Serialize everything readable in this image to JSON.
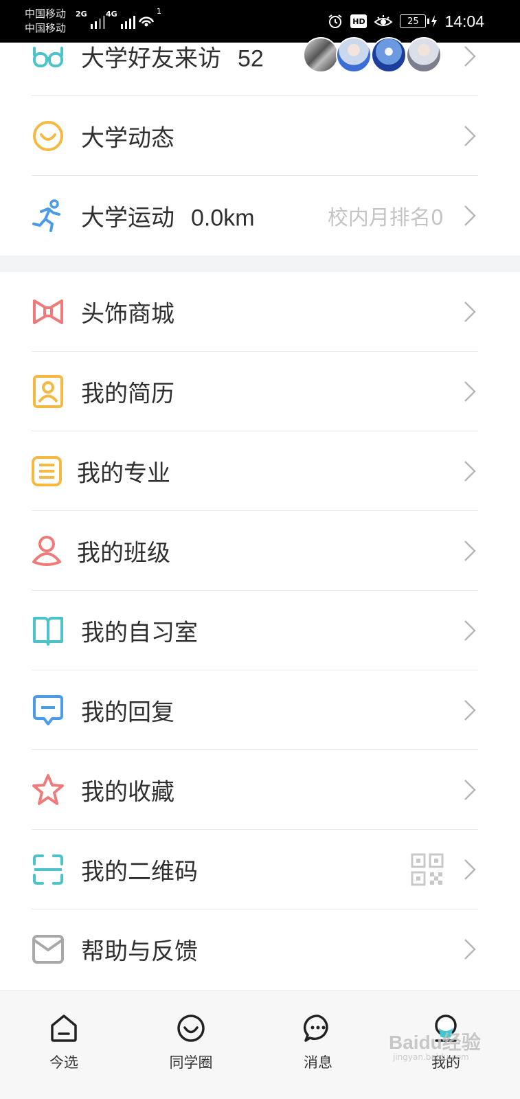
{
  "status_bar": {
    "carrier_1": "中国移动",
    "carrier_2": "中国移动",
    "network_1": "2G",
    "network_2": "4G",
    "hotspot_count": "1",
    "hd": "HD",
    "battery": "25",
    "time": "14:04"
  },
  "top_section": {
    "friend_visits": {
      "label": "大学好友来访",
      "count": "52"
    },
    "dynamics": {
      "label": "大学动态"
    },
    "sports": {
      "label": "大学运动",
      "distance": "0.0km",
      "rank_text": "校内月排名0"
    }
  },
  "menu": [
    {
      "label": "头饰商城",
      "icon": "bow-icon",
      "color": "#ef7a7a"
    },
    {
      "label": "我的简历",
      "icon": "resume-icon",
      "color": "#f5b942"
    },
    {
      "label": "我的专业",
      "icon": "major-icon",
      "color": "#f5b942"
    },
    {
      "label": "我的班级",
      "icon": "class-person-icon",
      "color": "#ef7a7a"
    },
    {
      "label": "我的自习室",
      "icon": "book-icon",
      "color": "#4cc3c9"
    },
    {
      "label": "我的回复",
      "icon": "reply-icon",
      "color": "#4a9ce8"
    },
    {
      "label": "我的收藏",
      "icon": "star-icon",
      "color": "#ef7a7a"
    },
    {
      "label": "我的二维码",
      "icon": "scan-icon",
      "color": "#4cc3c9"
    },
    {
      "label": "帮助与反馈",
      "icon": "mail-icon",
      "color": "#a8a8a8"
    }
  ],
  "tab_bar": {
    "tabs": [
      {
        "label": "今选",
        "icon": "home-icon"
      },
      {
        "label": "同学圈",
        "icon": "smile-circle-icon"
      },
      {
        "label": "消息",
        "icon": "chat-bubble-icon"
      },
      {
        "label": "我的",
        "icon": "profile-icon"
      }
    ]
  },
  "watermark": {
    "brand": "Baidu经验",
    "url": "jingyan.baidu.com"
  },
  "colors": {
    "icon_teal": "#4cc3c9",
    "icon_yellow": "#f5b942",
    "icon_blue": "#4a9ce8",
    "icon_red": "#ef7a7a",
    "section_gap": "#f3f4f6"
  }
}
